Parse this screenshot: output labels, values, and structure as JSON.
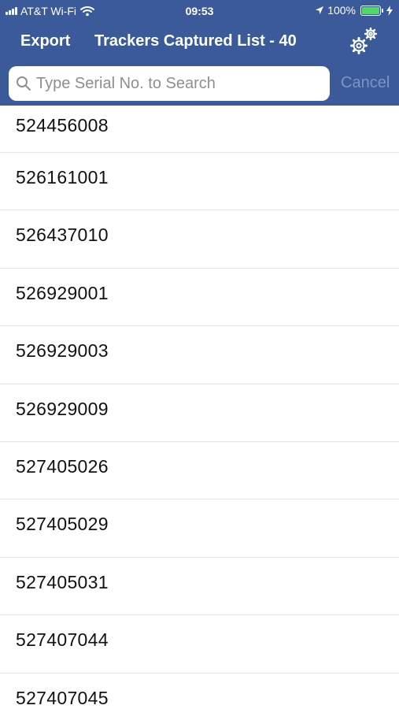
{
  "status_bar": {
    "carrier": "AT&T Wi-Fi",
    "time": "09:53",
    "battery_percent": "100%",
    "battery_level": 1.0,
    "icons": [
      "signal-bars-icon",
      "wifi-icon",
      "location-arrow-icon",
      "battery-icon",
      "charging-bolt-icon"
    ]
  },
  "nav": {
    "export_label": "Export",
    "title": "Trackers Captured List - 40",
    "settings_icon": "gears-icon"
  },
  "search": {
    "placeholder": "Type Serial No. to Search",
    "value": "",
    "cancel_label": "Cancel",
    "icon": "search-icon"
  },
  "colors": {
    "nav_background": "#3b5a99",
    "cancel_text": "#7d94c2",
    "battery_fill": "#4cd964"
  },
  "list": {
    "items": [
      {
        "serial": "524456008"
      },
      {
        "serial": "526161001"
      },
      {
        "serial": "526437010"
      },
      {
        "serial": "526929001"
      },
      {
        "serial": "526929003"
      },
      {
        "serial": "526929009"
      },
      {
        "serial": "527405026"
      },
      {
        "serial": "527405029"
      },
      {
        "serial": "527405031"
      },
      {
        "serial": "527407044"
      },
      {
        "serial": "527407045"
      }
    ]
  }
}
